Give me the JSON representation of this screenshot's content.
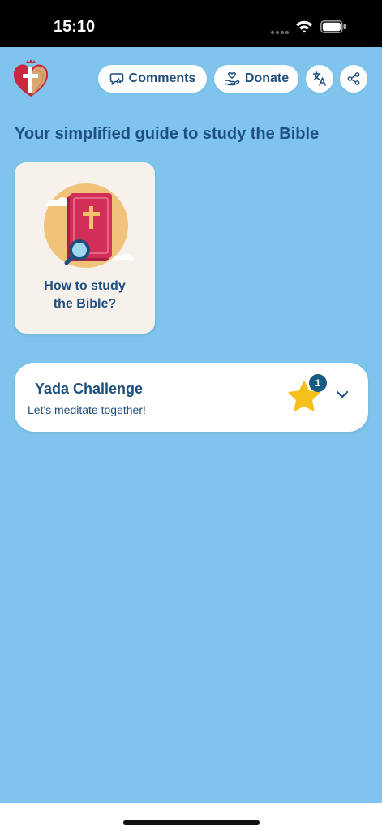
{
  "status": {
    "time": "15:10"
  },
  "header": {
    "comments_label": "Comments",
    "donate_label": "Donate"
  },
  "main": {
    "heading": "Your simplified guide to study the Bible",
    "guide_card": {
      "title_line1": "How to study",
      "title_line2": "the Bible?"
    },
    "challenge": {
      "title": "Yada Challenge",
      "subtitle": "Let's meditate together!",
      "badge_count": "1"
    }
  },
  "colors": {
    "background": "#7ec4ec",
    "primary_text": "#1e4f7e",
    "star": "#f6c01b",
    "badge": "#175a82"
  },
  "icons": [
    "heart-cross-logo-icon",
    "comment-star-icon",
    "hand-heart-icon",
    "translate-icon",
    "share-icon",
    "star-icon",
    "chevron-down-icon"
  ]
}
